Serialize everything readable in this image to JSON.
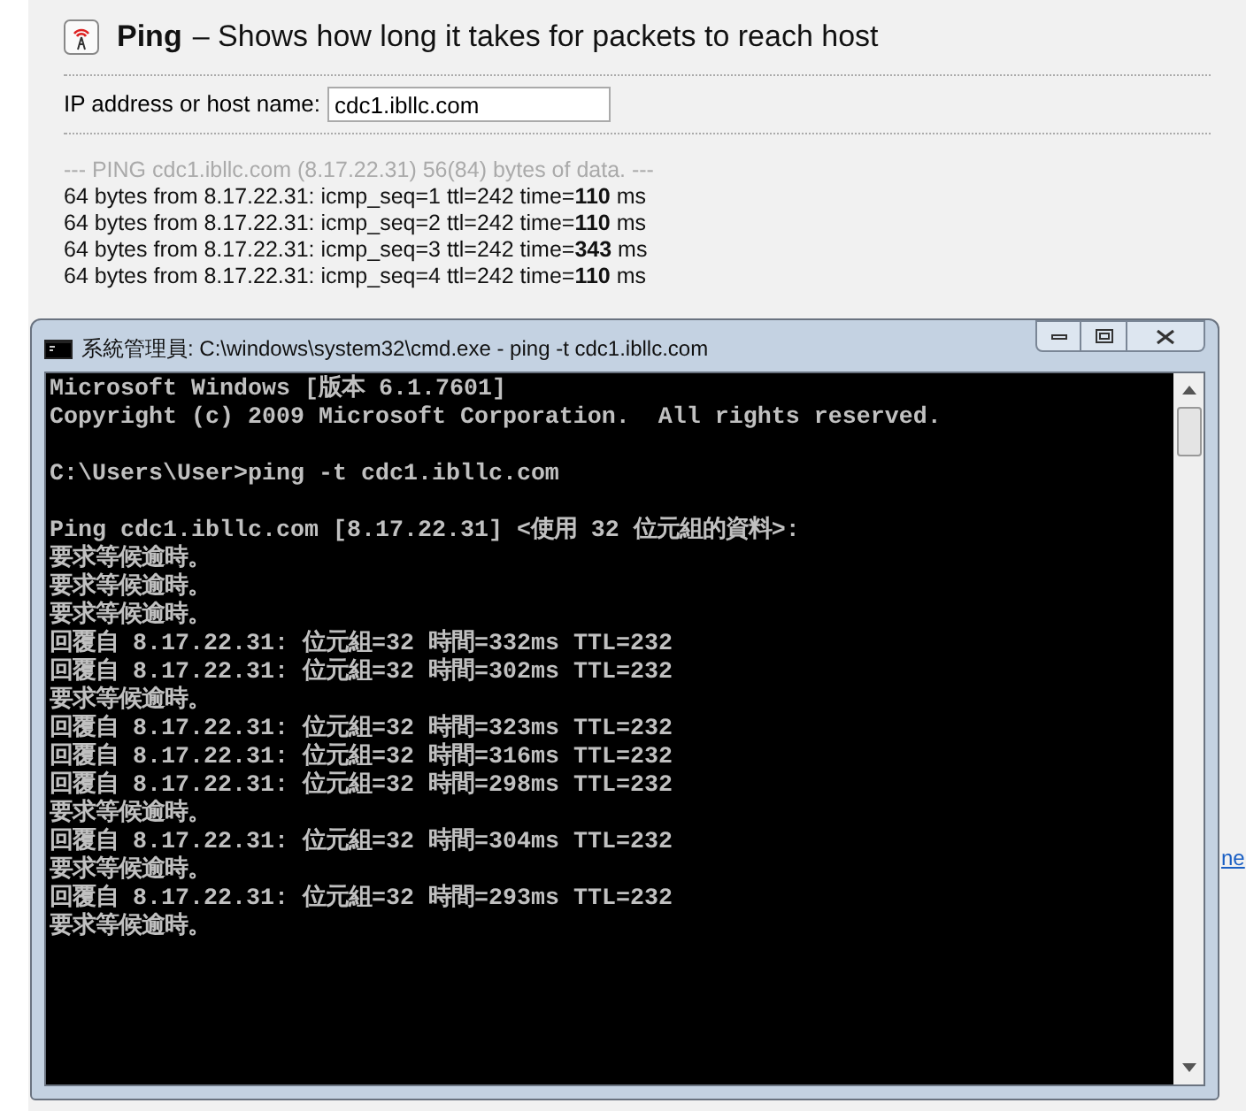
{
  "page": {
    "title": "Ping",
    "subtitle": "– Shows how long it takes for packets to reach host",
    "field_label": "IP address or host name:",
    "field_value": "cdc1.ibllc.com",
    "result_header": "--- PING cdc1.ibllc.com (8.17.22.31) 56(84) bytes of data. ---",
    "result_lines": [
      "64 bytes from 8.17.22.31: icmp_seq=1 ttl=242 time=**110** ms",
      "64 bytes from 8.17.22.31: icmp_seq=2 ttl=242 time=**110** ms",
      "64 bytes from 8.17.22.31: icmp_seq=3 ttl=242 time=**343** ms",
      "64 bytes from 8.17.22.31: icmp_seq=4 ttl=242 time=**110** ms"
    ],
    "link_fragment": "ne"
  },
  "console_window": {
    "title": "系統管理員: C:\\windows\\system32\\cmd.exe - ping  -t cdc1.ibllc.com",
    "blocks": [
      [
        "Microsoft Windows [版本 6.1.7601]",
        "Copyright (c) 2009 Microsoft Corporation.  All rights reserved."
      ],
      [
        "C:\\Users\\User>ping -t cdc1.ibllc.com"
      ],
      [
        "Ping cdc1.ibllc.com [8.17.22.31] <使用 32 位元組的資料>:",
        "要求等候逾時。",
        "要求等候逾時。",
        "要求等候逾時。",
        "回覆自 8.17.22.31: 位元組=32 時間=332ms TTL=232",
        "回覆自 8.17.22.31: 位元組=32 時間=302ms TTL=232",
        "要求等候逾時。",
        "回覆自 8.17.22.31: 位元組=32 時間=323ms TTL=232",
        "回覆自 8.17.22.31: 位元組=32 時間=316ms TTL=232",
        "回覆自 8.17.22.31: 位元組=32 時間=298ms TTL=232",
        "要求等候逾時。",
        "回覆自 8.17.22.31: 位元組=32 時間=304ms TTL=232",
        "要求等候逾時。",
        "回覆自 8.17.22.31: 位元組=32 時間=293ms TTL=232",
        "要求等候逾時。"
      ]
    ]
  }
}
